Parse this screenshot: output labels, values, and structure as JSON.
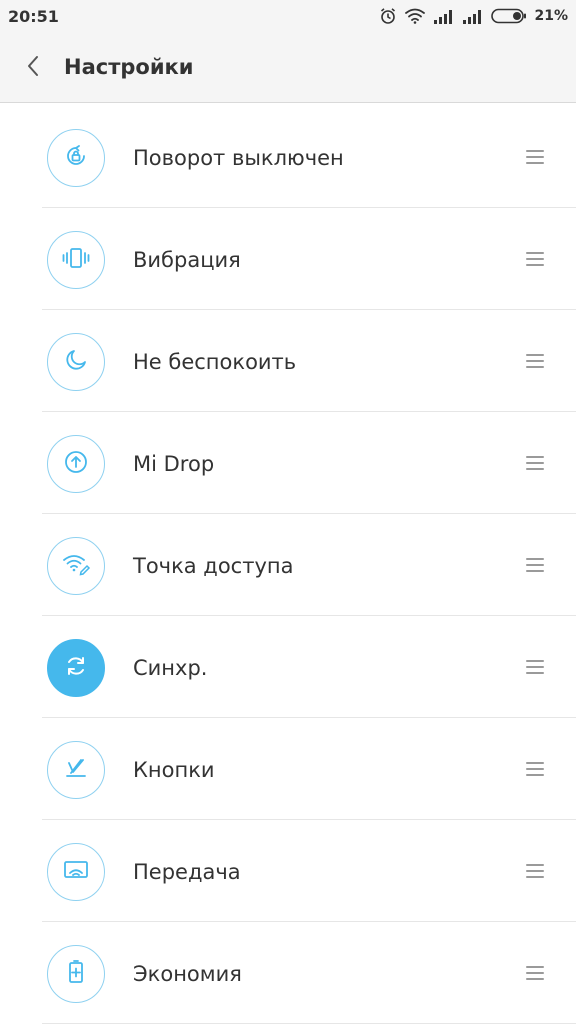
{
  "status_bar": {
    "time": "20:51",
    "battery_percent": "21%",
    "icons": [
      "alarm-icon",
      "wifi-icon",
      "signal-icon",
      "signal-icon",
      "battery-icon"
    ]
  },
  "header": {
    "title": "Настройки",
    "back_icon": "chevron-left-icon"
  },
  "colors": {
    "accent": "#45b8ec",
    "tile_border": "#8fd1f0",
    "header_bg": "#f5f5f5"
  },
  "toggles": [
    {
      "label": "Поворот выключен",
      "icon": "rotation-lock-icon",
      "active": false
    },
    {
      "label": "Вибрация",
      "icon": "vibration-icon",
      "active": false
    },
    {
      "label": "Не беспокоить",
      "icon": "moon-icon",
      "active": false
    },
    {
      "label": "Mi Drop",
      "icon": "upload-icon",
      "active": false
    },
    {
      "label": "Точка доступа",
      "icon": "hotspot-icon",
      "active": false
    },
    {
      "label": "Синхр.",
      "icon": "sync-icon",
      "active": true
    },
    {
      "label": "Кнопки",
      "icon": "buttons-icon",
      "active": false
    },
    {
      "label": "Передача",
      "icon": "cast-icon",
      "active": false
    },
    {
      "label": "Экономия",
      "icon": "battery-saver-icon",
      "active": false
    }
  ]
}
